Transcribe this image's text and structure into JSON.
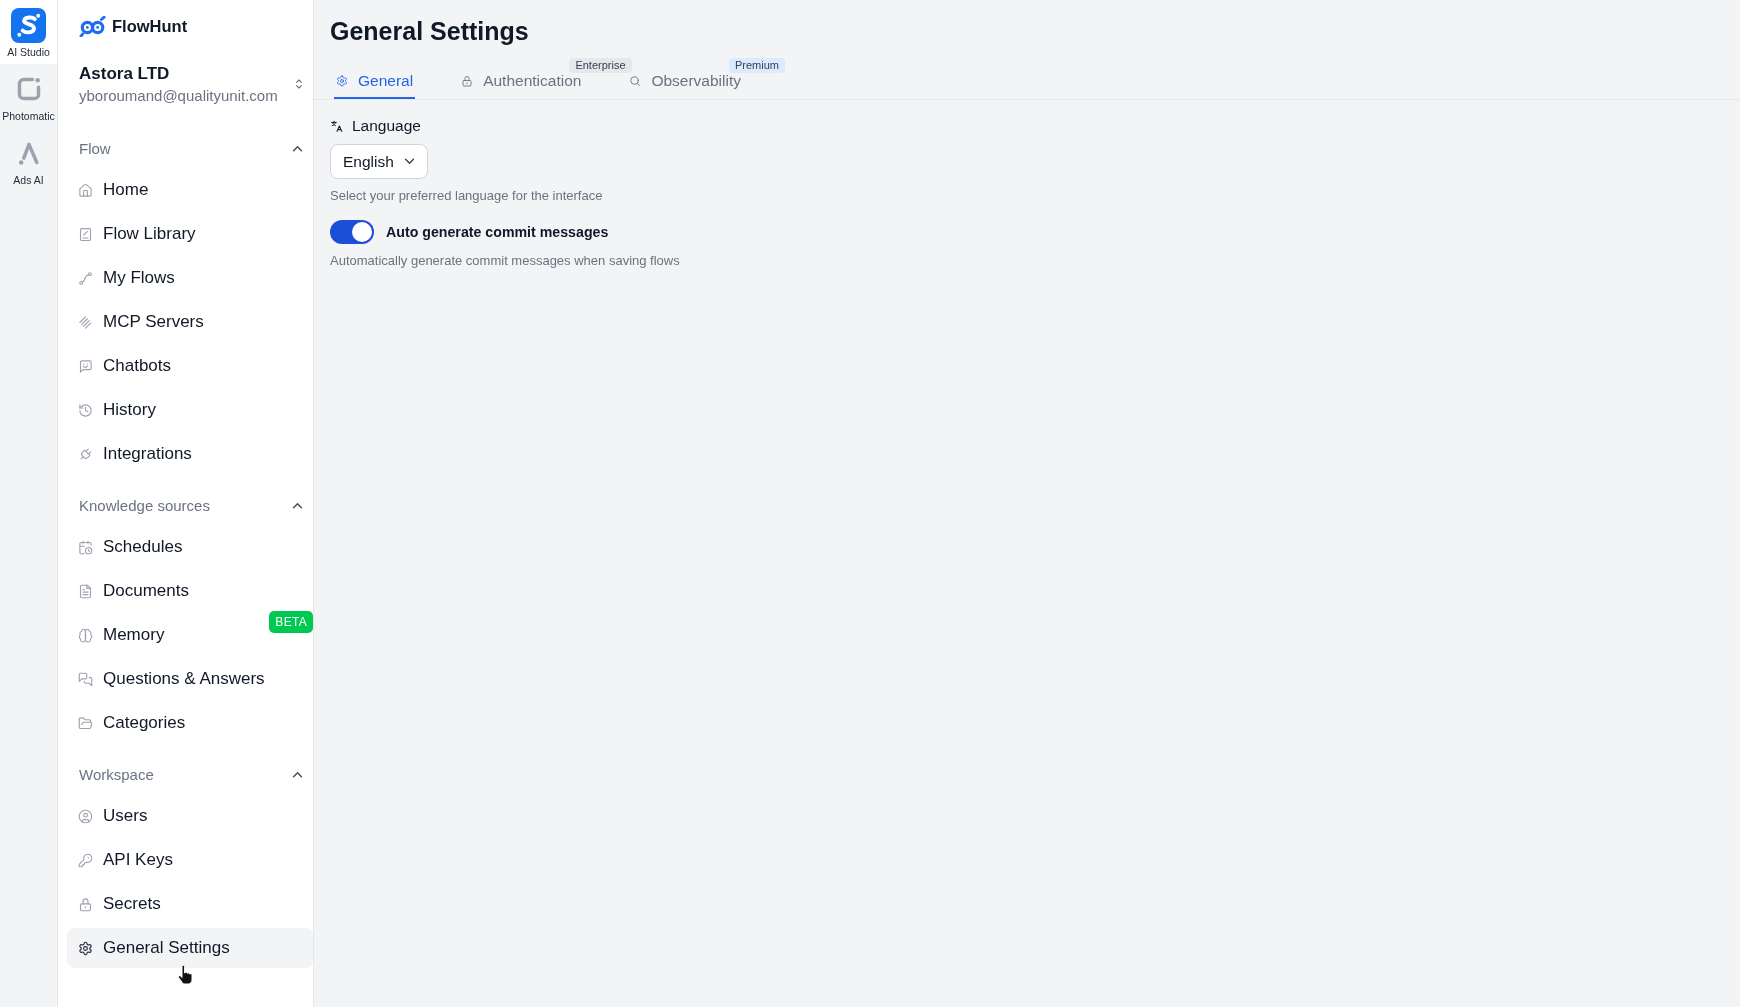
{
  "app_switcher": [
    {
      "label": "AI Studio",
      "selected": true
    },
    {
      "label": "Photomatic",
      "selected": false
    },
    {
      "label": "Ads AI",
      "selected": false
    }
  ],
  "sidebar": {
    "brand": "FlowHunt",
    "workspace": {
      "name": "Astora LTD",
      "email": "yboroumand@qualityunit.com"
    },
    "sections": [
      {
        "title": "Flow",
        "expanded": true,
        "items": [
          {
            "label": "Home",
            "selected": false
          },
          {
            "label": "Flow Library",
            "selected": false
          },
          {
            "label": "My Flows",
            "selected": false
          },
          {
            "label": "MCP Servers",
            "selected": false
          },
          {
            "label": "Chatbots",
            "selected": false
          },
          {
            "label": "History",
            "selected": false
          },
          {
            "label": "Integrations",
            "selected": false
          }
        ]
      },
      {
        "title": "Knowledge sources",
        "expanded": true,
        "items": [
          {
            "label": "Schedules",
            "selected": false
          },
          {
            "label": "Documents",
            "selected": false
          },
          {
            "label": "Memory",
            "selected": false,
            "badge": {
              "text": "BETA",
              "color": "#00c951"
            }
          },
          {
            "label": "Questions & Answers",
            "selected": false
          },
          {
            "label": "Categories",
            "selected": false
          }
        ]
      },
      {
        "title": "Workspace",
        "expanded": true,
        "items": [
          {
            "label": "Users",
            "selected": false
          },
          {
            "label": "API Keys",
            "selected": false
          },
          {
            "label": "Secrets",
            "selected": false
          },
          {
            "label": "General Settings",
            "selected": true
          }
        ]
      }
    ]
  },
  "page": {
    "title": "General Settings",
    "tabs": [
      {
        "label": "General",
        "selected": true
      },
      {
        "label": "Authentication",
        "selected": false,
        "badge": {
          "text": "Enterprise",
          "color": "#e5e7eb"
        }
      },
      {
        "label": "Observability",
        "selected": false,
        "badge": {
          "text": "Premium",
          "color": "#dbeafe"
        }
      }
    ],
    "language": {
      "label": "Language",
      "value": "English",
      "hint": "Select your preferred language for the interface"
    },
    "auto_commit": {
      "label": "Auto generate commit messages",
      "on": true,
      "hint": "Automatically generate commit messages when saving flows"
    }
  }
}
